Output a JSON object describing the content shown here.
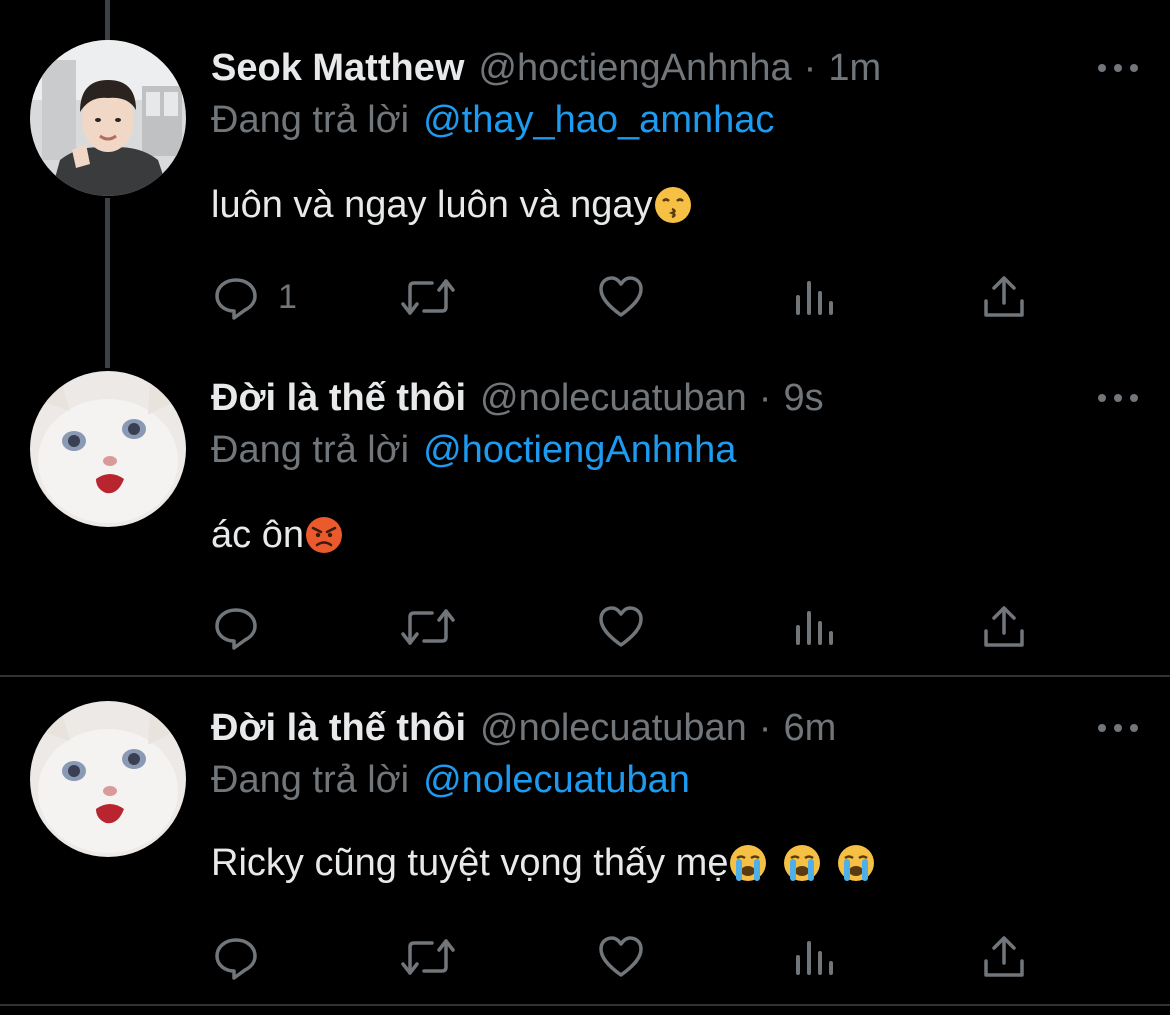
{
  "tweets": [
    {
      "author_name": "Seok Matthew",
      "handle": "@hoctiengAnhnha",
      "time": "1m",
      "reply_label": "Đang trả lời",
      "reply_to": "@thay_hao_amnhac",
      "text": "luôn và ngay luôn và ngay",
      "emojis": [
        "kissing-face-emoji"
      ],
      "reply_count": "1",
      "avatar": "person-photo"
    },
    {
      "author_name": "Đời là thế thôi",
      "handle": "@nolecuatuban",
      "time": "9s",
      "reply_label": "Đang trả lời",
      "reply_to": "@hoctiengAnhnha",
      "text": "ác ôn",
      "emojis": [
        "angry-face-emoji"
      ],
      "reply_count": "",
      "avatar": "white-cat-photo"
    },
    {
      "author_name": "Đời là thế thôi",
      "handle": "@nolecuatuban",
      "time": "6m",
      "reply_label": "Đang trả lời",
      "reply_to": "@nolecuatuban",
      "text": "Ricky cũng tuyệt vọng thấy mẹ",
      "emojis": [
        "crying-face-emoji",
        "crying-face-emoji",
        "crying-face-emoji"
      ],
      "reply_count": "",
      "avatar": "white-cat-photo"
    }
  ],
  "separator": "·",
  "icons": {
    "reply": "reply-icon",
    "retweet": "retweet-icon",
    "like": "like-icon",
    "views": "views-icon",
    "share": "share-icon",
    "more": "more-icon"
  },
  "colors": {
    "background": "#000000",
    "primary_text": "#e7e9ea",
    "secondary_text": "#71767b",
    "link": "#1d9bf0",
    "divider": "#2f3336",
    "thread_line": "#3e4144"
  }
}
